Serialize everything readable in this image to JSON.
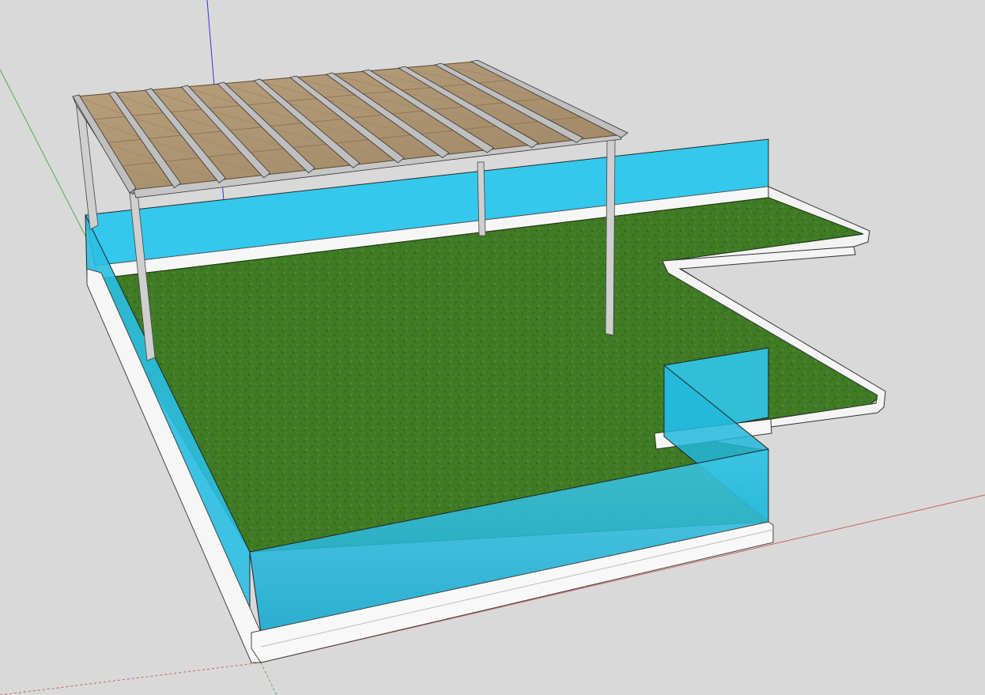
{
  "app": {
    "viewport_background": "#d9d9d9"
  },
  "scene": {
    "objects": [
      "axis-red",
      "axis-green",
      "axis-blue",
      "grass-terrace",
      "glass-railing-back",
      "glass-railing-left",
      "glass-railing-front",
      "glass-railing-inner",
      "pergola",
      "pergola-shade-sails"
    ],
    "colors": {
      "grass": "#3f7a25",
      "grass_dark": "#2f6a1c",
      "glass_back": "#2fc6ea",
      "glass_front": "#1bb4d6",
      "curb": "#f6f6f6",
      "curb_shadow": "#bdbdbd",
      "sail": "#b39a78",
      "sail_dark": "#8e7656",
      "pergola_frame": "#c9c9c9",
      "axis_red": "#c8625f",
      "axis_green": "#4caf50",
      "axis_blue": "#2b3fd0"
    }
  }
}
